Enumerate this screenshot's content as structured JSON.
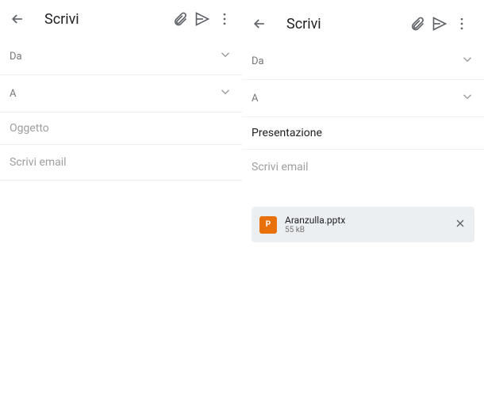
{
  "left": {
    "title": "Scrivi",
    "from_label": "Da",
    "to_label": "A",
    "subject_placeholder": "Oggetto",
    "body_placeholder": "Scrivi email"
  },
  "right": {
    "title": "Scrivi",
    "from_label": "Da",
    "to_label": "A",
    "subject_value": "Presentazione",
    "body_placeholder": "Scrivi email",
    "attachment": {
      "icon_letter": "P",
      "name": "Aranzulla.pptx",
      "size": "55 kB"
    }
  }
}
